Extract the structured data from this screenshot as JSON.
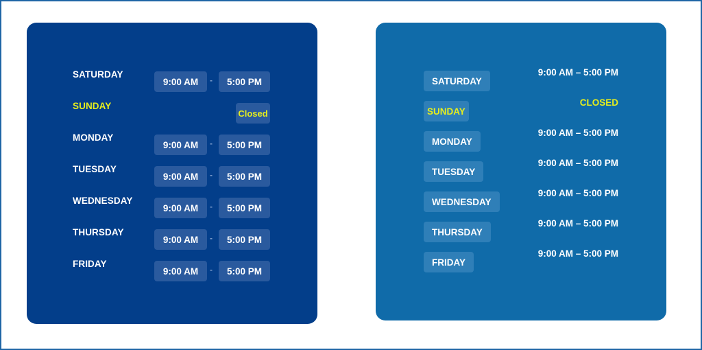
{
  "colors": {
    "left_card_bg": "#033e8a",
    "right_card_bg": "#106ba9",
    "pill_bg_left": "#2a5a9e",
    "pill_bg_right": "#2f7fb8",
    "text": "#ffffff",
    "closed_accent": "#e6ee1d"
  },
  "left_card": {
    "separator": "-",
    "rows": [
      {
        "day": "SATURDAY",
        "open": "9:00 AM",
        "close": "5:00 PM",
        "closed": false
      },
      {
        "day": "SUNDAY",
        "status": "Closed",
        "closed": true
      },
      {
        "day": "MONDAY",
        "open": "9:00 AM",
        "close": "5:00 PM",
        "closed": false
      },
      {
        "day": "TUESDAY",
        "open": "9:00 AM",
        "close": "5:00 PM",
        "closed": false
      },
      {
        "day": "WEDNESDAY",
        "open": "9:00 AM",
        "close": "5:00 PM",
        "closed": false
      },
      {
        "day": "THURSDAY",
        "open": "9:00 AM",
        "close": "5:00 PM",
        "closed": false
      },
      {
        "day": "FRIDAY",
        "open": "9:00 AM",
        "close": "5:00 PM",
        "closed": false
      }
    ]
  },
  "right_card": {
    "rows": [
      {
        "day": "SATURDAY",
        "hours": "9:00 AM – 5:00 PM",
        "closed": false
      },
      {
        "day": "SUNDAY",
        "hours": "CLOSED",
        "closed": true
      },
      {
        "day": "MONDAY",
        "hours": "9:00 AM – 5:00 PM",
        "closed": false
      },
      {
        "day": "TUESDAY",
        "hours": "9:00 AM – 5:00 PM",
        "closed": false
      },
      {
        "day": "WEDNESDAY",
        "hours": "9:00 AM – 5:00 PM",
        "closed": false
      },
      {
        "day": "THURSDAY",
        "hours": "9:00 AM – 5:00 PM",
        "closed": false
      },
      {
        "day": "FRIDAY",
        "hours": "9:00 AM – 5:00 PM",
        "closed": false
      }
    ]
  }
}
